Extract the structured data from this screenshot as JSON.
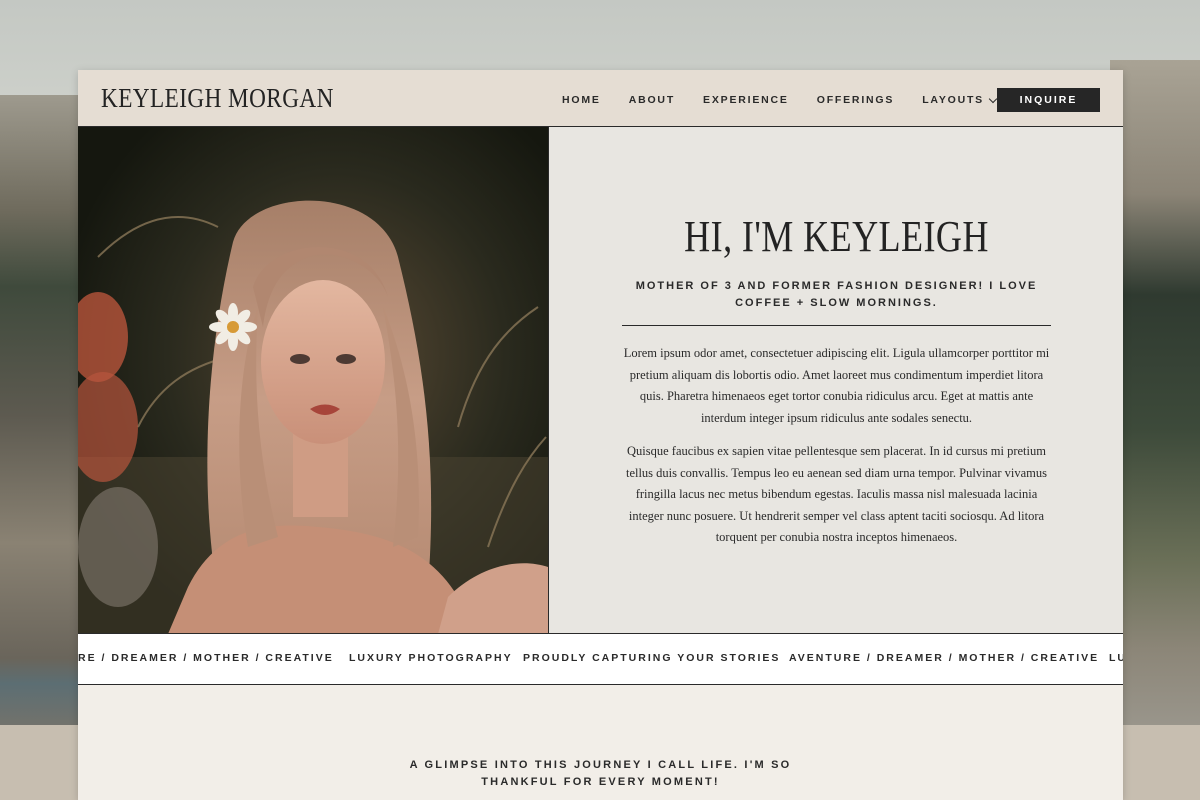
{
  "site": {
    "logo": "KEYLEIGH MORGAN",
    "nav": {
      "home": "HOME",
      "about": "ABOUT",
      "experience": "EXPERIENCE",
      "offerings": "OFFERINGS",
      "layouts": "LAYOUTS",
      "inquire": "INQUIRE"
    },
    "hero": {
      "title": "HI, I'M KEYLEIGH",
      "subtitle": "MOTHER OF 3 AND FORMER FASHION DESIGNER! I LOVE COFFEE + SLOW MORNINGS.",
      "paragraph_1": "Lorem ipsum odor amet, consectetuer adipiscing elit. Ligula ullamcorper porttitor mi pretium aliquam dis lobortis odio. Amet laoreet mus condimentum imperdiet litora quis. Pharetra himenaeos eget tortor conubia ridiculus arcu. Eget at mattis ante interdum integer ipsum ridiculus ante sodales senectu.",
      "paragraph_2": "Quisque faucibus ex sapien vitae pellentesque sem placerat. In id cursus mi pretium tellus duis convallis. Tempus leo eu aenean sed diam urna tempor. Pulvinar vivamus fringilla lacus nec metus bibendum egestas. Iaculis massa nisl malesuada lacinia integer nunc posuere. Ut hendrerit semper vel class aptent taciti sociosqu. Ad litora torquent per conubia nostra inceptos himenaeos."
    },
    "marquee": {
      "item_1": "RE / DREAMER / MOTHER / CREATIVE",
      "item_2": "LUXURY PHOTOGRAPHY",
      "item_3": "PROUDLY CAPTURING YOUR STORIES",
      "item_4": "AVENTURE / DREAMER / MOTHER / CREATIVE",
      "item_5": "LU"
    },
    "lower": {
      "text": "A GLIMPSE INTO THIS JOURNEY I CALL LIFE. I'M SO THANKFUL FOR EVERY MOMENT!"
    }
  },
  "colors": {
    "nav_bg": "#e5ddd3",
    "hero_text_bg": "#e8e6e1",
    "page_bg": "#f2eee8",
    "accent_dark": "#262626"
  }
}
